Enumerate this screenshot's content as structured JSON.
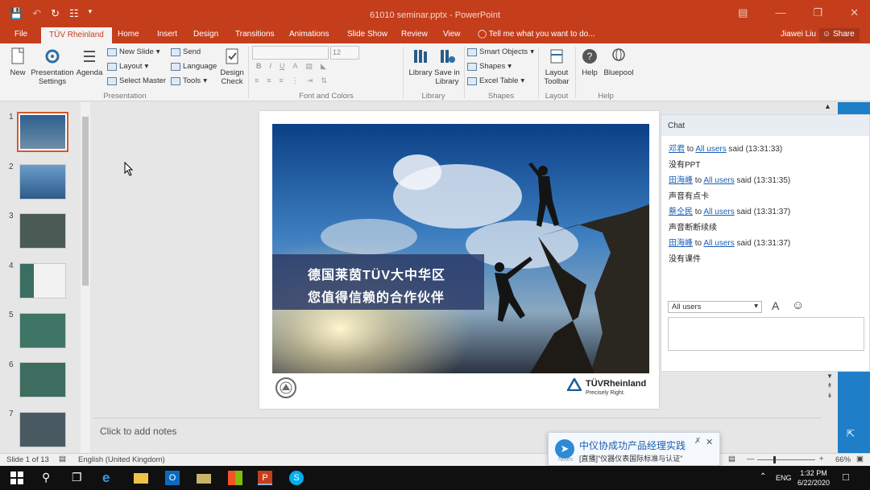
{
  "app": {
    "document_title": "61010 seminar.pptx - PowerPoint",
    "user_name": "Jiawei Liu",
    "share_label": "Share"
  },
  "qat": {
    "save_icon": "save-icon",
    "undo_icon": "undo-icon",
    "redo_icon": "redo-icon",
    "present_icon": "present-icon"
  },
  "tabs": [
    "File",
    "TÜV Rheinland",
    "Home",
    "Insert",
    "Design",
    "Transitions",
    "Animations",
    "Slide Show",
    "Review",
    "View"
  ],
  "active_tab": "TÜV Rheinland",
  "tell_me": "Tell me what you want to do...",
  "ribbon": {
    "presentation": {
      "new": "New",
      "pres_settings": "Presentation Settings",
      "agenda": "Agenda",
      "new_slide": "New Slide",
      "layout": "Layout",
      "select_master": "Select Master",
      "send": "Send",
      "language": "Language",
      "tools": "Tools",
      "design_check": "Design Check",
      "label": "Presentation"
    },
    "font": {
      "size": "12",
      "bold": "B",
      "italic": "I",
      "underline": "U",
      "label": "Font and Colors"
    },
    "library": {
      "library": "Library",
      "save_in_library": "Save in Library",
      "label": "Library"
    },
    "shapes": {
      "smart_objects": "Smart Objects",
      "shapes": "Shapes",
      "excel_table": "Excel Table",
      "label": "Shapes"
    },
    "layout": {
      "layout_toolbar": "Layout Toolbar",
      "label": "Layout"
    },
    "help": {
      "help": "Help",
      "bluepool": "Bluepool",
      "label": "Help"
    }
  },
  "thumbnails": [
    "1",
    "2",
    "3",
    "4",
    "5",
    "6",
    "7"
  ],
  "selected_slide": 1,
  "slide": {
    "banner_line1": "德国莱茵TÜV大中华区",
    "banner_line2": "您值得信赖的合作伙伴",
    "logo_text": "TÜVRheinland",
    "logo_sub": "Precisely Right."
  },
  "notes_placeholder": "Click to add notes",
  "chat": {
    "title": "Chat",
    "messages": [
      {
        "sender": "邓君",
        "to_word": "to",
        "target": "All users",
        "said": "said (13:31:33)",
        "text": "没有PPT"
      },
      {
        "sender": "田海峰",
        "to_word": "to",
        "target": "All users",
        "said": "said (13:31:35)",
        "text": "声音有点卡"
      },
      {
        "sender": "蔡仝民",
        "to_word": "to",
        "target": "All users",
        "said": "said (13:31:37)",
        "text": "声音断断续续"
      },
      {
        "sender": "田海峰",
        "to_word": "to",
        "target": "All users",
        "said": "said (13:31:37)",
        "text": "没有课件"
      }
    ],
    "recipient": "All users"
  },
  "status": {
    "slide_of": "Slide 1 of 13",
    "language": "English (United Kingdom)",
    "notes": "Notes",
    "zoom": "66%"
  },
  "toast": {
    "title": "中仪协成功产品经理实践",
    "body": "[直播]\"仪器仪表国际标准与认证\""
  },
  "taskbar": {
    "time": "1:32 PM",
    "date": "6/22/2020",
    "lang": "ENG"
  },
  "colors": {
    "ppt_orange": "#c43e1c",
    "accent_blue": "#1e7ec8",
    "link_blue": "#1a5fb4"
  }
}
